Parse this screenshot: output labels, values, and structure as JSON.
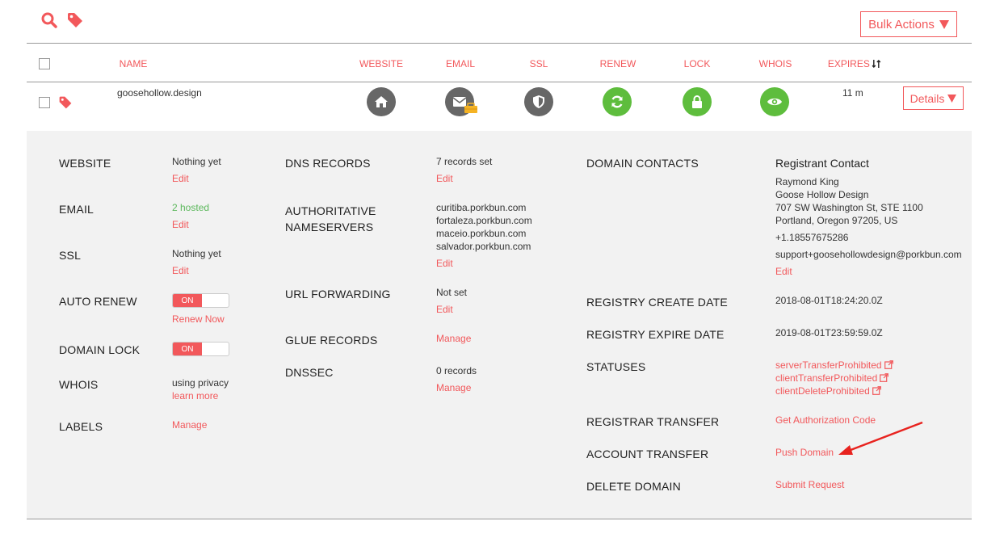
{
  "toolbar": {
    "icons": [
      "search-icon",
      "tag-icon"
    ],
    "bulk_actions_label": "Bulk Actions"
  },
  "table": {
    "columns": [
      "NAME",
      "WEBSITE",
      "EMAIL",
      "SSL",
      "RENEW",
      "LOCK",
      "WHOIS",
      "EXPIRES"
    ],
    "row": {
      "domain": "goosehollow.design",
      "expires": "11 m",
      "details_label": "Details",
      "status_icons": [
        "home-icon",
        "envelope-icon",
        "shield-icon",
        "refresh-icon",
        "lock-icon",
        "eye-icon"
      ]
    }
  },
  "details": {
    "col1": {
      "website": {
        "label": "WEBSITE",
        "value": "Nothing yet",
        "link": "Edit"
      },
      "email": {
        "label": "EMAIL",
        "value": "2 hosted",
        "link": "Edit"
      },
      "ssl": {
        "label": "SSL",
        "value": "Nothing yet",
        "link": "Edit"
      },
      "auto_renew": {
        "label": "AUTO RENEW",
        "toggle": "ON",
        "link": "Renew Now"
      },
      "domain_lock": {
        "label": "DOMAIN LOCK",
        "toggle": "ON"
      },
      "whois": {
        "label": "WHOIS",
        "value": "using privacy",
        "link": "learn more"
      },
      "labels": {
        "label": "LABELS",
        "link": "Manage"
      }
    },
    "col2": {
      "dns_records": {
        "label": "DNS RECORDS",
        "value": "7 records set",
        "link": "Edit"
      },
      "nameservers": {
        "label_line1": "AUTHORITATIVE",
        "label_line2": "NAMESERVERS",
        "values": [
          "curitiba.porkbun.com",
          "fortaleza.porkbun.com",
          "maceio.porkbun.com",
          "salvador.porkbun.com"
        ],
        "link": "Edit"
      },
      "url_forwarding": {
        "label": "URL FORWARDING",
        "value": "Not set",
        "link": "Edit"
      },
      "glue_records": {
        "label": "GLUE RECORDS",
        "link": "Manage"
      },
      "dnssec": {
        "label": "DNSSEC",
        "value": "0 records",
        "link": "Manage"
      }
    },
    "col3": {
      "domain_contacts": {
        "label": "DOMAIN CONTACTS",
        "heading": "Registrant Contact",
        "name": "Raymond King",
        "org": "Goose Hollow Design",
        "street": "707 SW Washington St, STE 1100",
        "city": "Portland, Oregon 97205, US",
        "phone": "+1.18557675286",
        "email": "support+goosehollowdesign@porkbun.com",
        "link": "Edit"
      },
      "create_date": {
        "label": "REGISTRY CREATE DATE",
        "value": "2018-08-01T18:24:20.0Z"
      },
      "expire_date": {
        "label": "REGISTRY EXPIRE DATE",
        "value": "2019-08-01T23:59:59.0Z"
      },
      "statuses": {
        "label": "STATUSES",
        "values": [
          "serverTransferProhibited",
          "clientTransferProhibited",
          "clientDeleteProhibited"
        ]
      },
      "registrar_transfer": {
        "label": "REGISTRAR TRANSFER",
        "link": "Get Authorization Code"
      },
      "account_transfer": {
        "label": "ACCOUNT TRANSFER",
        "link": "Push Domain"
      },
      "delete_domain": {
        "label": "DELETE DOMAIN",
        "link": "Submit Request"
      }
    }
  },
  "colors": {
    "accent": "#f2585b",
    "green": "#5ebd3d",
    "grey_icon": "#676767",
    "panel_bg": "#f2f2f2",
    "arrow": "#e8231f"
  }
}
